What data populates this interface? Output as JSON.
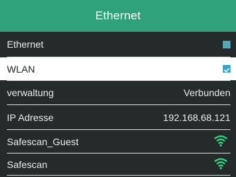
{
  "header": {
    "title": "Ethernet"
  },
  "rows": [
    {
      "label": "Ethernet",
      "control": "checkbox",
      "checked": false
    },
    {
      "label": "WLAN",
      "control": "checkbox",
      "checked": true
    },
    {
      "label": "verwaltung",
      "value": "Verbunden"
    },
    {
      "label": "IP Adresse",
      "value": "192.168.68.121"
    },
    {
      "label": "Safescan_Guest",
      "icon": "wifi-icon"
    },
    {
      "label": "Safescan",
      "icon": "wifi-icon"
    }
  ],
  "colors": {
    "header": "#2fa27b",
    "background": "#252b2a",
    "selected_row": "#ffffff",
    "checkbox": "#3aa0c2",
    "wifi": "#2fd07c"
  }
}
